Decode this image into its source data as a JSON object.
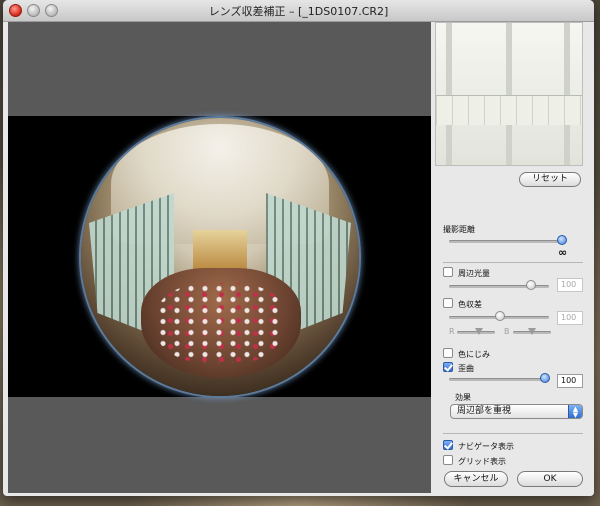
{
  "window": {
    "title": "レンズ収差補正 – [_1DS0107.CR2]"
  },
  "panel": {
    "reset_label": "リセット",
    "shooting_distance": {
      "label": "撮影距離",
      "infinity_symbol": "∞"
    },
    "peripheral_illumination": {
      "label": "周辺光量",
      "value": "100",
      "checked": false
    },
    "chromatic_aberration": {
      "label": "色収差",
      "value": "100",
      "checked": false,
      "r_label": "R",
      "b_label": "B"
    },
    "color_blur": {
      "label": "色にじみ",
      "checked": false
    },
    "distortion": {
      "label": "歪曲",
      "value": "100",
      "checked": true
    },
    "effect": {
      "label": "効果",
      "selected": "周辺部を重視"
    },
    "navigator": {
      "label": "ナビゲータ表示",
      "checked": true
    },
    "grid": {
      "label": "グリッド表示",
      "checked": false
    },
    "cancel_label": "キャンセル",
    "ok_label": "OK"
  },
  "colors": {
    "accent": "#3f7fd8",
    "viewer_bg": "#595959",
    "panel_bg": "#e8e8e8"
  }
}
